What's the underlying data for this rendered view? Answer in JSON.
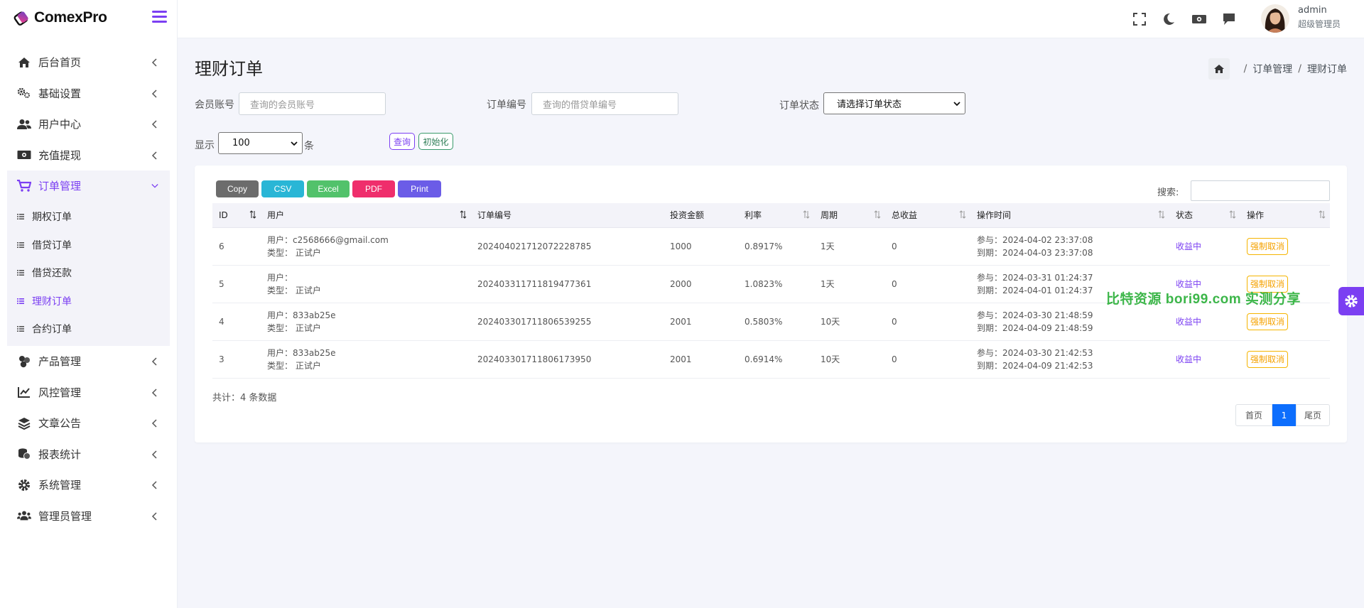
{
  "brand": {
    "name": "ComexPro"
  },
  "sidebar": {
    "items": [
      {
        "label": "后台首页",
        "icon": "home-icon"
      },
      {
        "label": "基础设置",
        "icon": "cogs-icon"
      },
      {
        "label": "用户中心",
        "icon": "users-icon"
      },
      {
        "label": "充值提现",
        "icon": "money-icon"
      },
      {
        "label": "订单管理",
        "icon": "cart-icon",
        "active": true
      },
      {
        "label": "产品管理",
        "icon": "cubes-icon"
      },
      {
        "label": "风控管理",
        "icon": "chart-line-icon"
      },
      {
        "label": "文章公告",
        "icon": "layers-icon"
      },
      {
        "label": "报表统计",
        "icon": "coins-icon"
      },
      {
        "label": "系统管理",
        "icon": "gear-icon"
      },
      {
        "label": "管理员管理",
        "icon": "user-group-icon"
      }
    ],
    "submenu": [
      {
        "label": "期权订单"
      },
      {
        "label": "借贷订单"
      },
      {
        "label": "借贷还款"
      },
      {
        "label": "理财订单",
        "current": true
      },
      {
        "label": "合约订单"
      }
    ]
  },
  "header": {
    "user_name": "admin",
    "user_role": "超级管理员"
  },
  "page": {
    "title": "理财订单",
    "breadcrumb": [
      "订单管理",
      "理财订单"
    ],
    "breadcrumb_sep": "/"
  },
  "filters": {
    "member_label": "会员账号",
    "member_placeholder": "查询的会员账号",
    "order_label": "订单编号",
    "order_placeholder": "查询的借贷单编号",
    "status_label": "订单状态",
    "status_value": "请选择订单状态",
    "show_label": "显示",
    "show_value": "100",
    "show_unit": "条",
    "query_btn": "查询",
    "reset_btn": "初始化"
  },
  "export": {
    "copy": "Copy",
    "csv": "CSV",
    "excel": "Excel",
    "pdf": "PDF",
    "print": "Print"
  },
  "search_label": "搜索:",
  "table": {
    "columns": [
      "ID",
      "用户",
      "订单编号",
      "投资金额",
      "利率",
      "周期",
      "总收益",
      "操作时间",
      "状态",
      "操作"
    ],
    "rows": [
      {
        "id": "6",
        "user": "用户：c2568666@gmail.com",
        "type": "类型： 正试户",
        "order_no": "20240402171207222878​5",
        "amount": "1000",
        "rate": "0.8917%",
        "period": "1天",
        "income": "0",
        "join": "参与：2024-04-02 23:37:08",
        "expire": "到期：2024-04-03 23:37:08",
        "status": "收益中",
        "action": "强制取消"
      },
      {
        "id": "5",
        "user": "用户：",
        "type": "类型： 正试户",
        "order_no": "202403311711819477361",
        "amount": "2000",
        "rate": "1.0823%",
        "period": "1天",
        "income": "0",
        "join": "参与：2024-03-31 01:24:37",
        "expire": "到期：2024-04-01 01:24:37",
        "status": "收益中",
        "action": "强制取消"
      },
      {
        "id": "4",
        "user": "用户：833ab25e",
        "type": "类型： 正试户",
        "order_no": "202403301711806539255",
        "amount": "2001",
        "rate": "0.5803%",
        "period": "10天",
        "income": "0",
        "join": "参与：2024-03-30 21:48:59",
        "expire": "到期：2024-04-09 21:48:59",
        "status": "收益中",
        "action": "强制取消"
      },
      {
        "id": "3",
        "user": "用户：833ab25e",
        "type": "类型： 正试户",
        "order_no": "202403301711806173950",
        "amount": "2001",
        "rate": "0.6914%",
        "period": "10天",
        "income": "0",
        "join": "参与：2024-03-30 21:42:53",
        "expire": "到期：2024-04-09 21:42:53",
        "status": "收益中",
        "action": "强制取消"
      }
    ]
  },
  "total_text": "共计：4 条数据",
  "pagination": {
    "first": "首页",
    "current": "1",
    "last": "尾页"
  },
  "watermark": "比特资源 bori99.com 实测分享",
  "colors": {
    "accent": "#7b3ff2",
    "copy": "#6c6c6c",
    "csv": "#29b6d6",
    "excel": "#52c26b",
    "pdf": "#ef2e6c",
    "print": "#6b5ce7",
    "warning": "#f5b400",
    "primary": "#0d6efd"
  }
}
